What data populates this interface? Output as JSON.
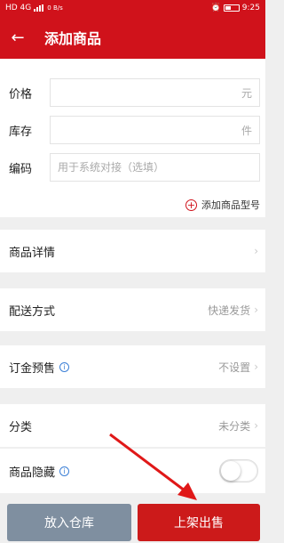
{
  "status_bar": {
    "carrier_left": "HD 4G",
    "net_speed": "0 B/s",
    "battery": "19",
    "time": "9:25"
  },
  "header": {
    "title": "添加商品"
  },
  "form": {
    "price_label": "价格",
    "price_unit": "元",
    "stock_label": "库存",
    "stock_unit": "件",
    "code_label": "编码",
    "code_placeholder": "用于系统对接（选填）"
  },
  "add_model": {
    "label": "添加商品型号"
  },
  "items": {
    "detail": {
      "label": "商品详情"
    },
    "delivery": {
      "label": "配送方式",
      "value": "快递发货"
    },
    "deposit": {
      "label": "订金预售",
      "value": "不设置"
    },
    "category": {
      "label": "分类",
      "value": "未分类"
    },
    "hidden": {
      "label": "商品隐藏",
      "enabled": false
    }
  },
  "buttons": {
    "store": "放入仓库",
    "sell": "上架出售"
  },
  "colors": {
    "brand_red": "#d0121b",
    "button_gray": "#7f8fa0",
    "info_blue": "#3b7fd6"
  }
}
